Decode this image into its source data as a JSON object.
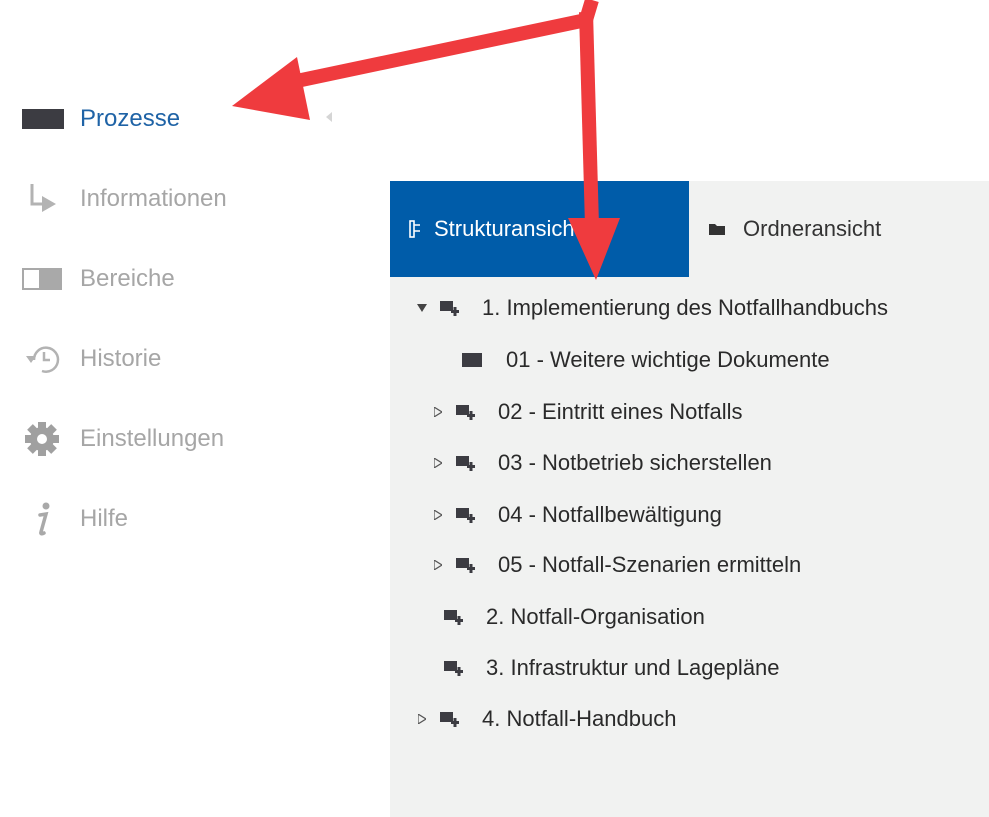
{
  "sidebar": {
    "items": [
      {
        "label": "Prozesse",
        "icon": "process-block-icon",
        "active": true
      },
      {
        "label": "Informationen",
        "icon": "info-arrow-icon",
        "active": false
      },
      {
        "label": "Bereiche",
        "icon": "areas-panel-icon",
        "active": false
      },
      {
        "label": "Historie",
        "icon": "history-clock-icon",
        "active": false
      },
      {
        "label": "Einstellungen",
        "icon": "gear-icon",
        "active": false
      },
      {
        "label": "Hilfe",
        "icon": "info-i-icon",
        "active": false
      }
    ]
  },
  "panel": {
    "tabs": [
      {
        "label": "Strukturansicht",
        "icon": "structure-view-icon",
        "active": true
      },
      {
        "label": "Ordneransicht",
        "icon": "folder-icon",
        "active": false
      }
    ],
    "tree": [
      {
        "label": "1. Implementierung des Notfallhandbuchs",
        "toggle": "expanded",
        "icon": "process-add-icon"
      },
      {
        "label": "01 - Weitere wichtige Dokumente",
        "toggle": "none",
        "icon": "document-block-icon"
      },
      {
        "label": "02 - Eintritt eines Notfalls",
        "toggle": "collapsed",
        "icon": "process-add-icon"
      },
      {
        "label": "03 - Notbetrieb sicherstellen",
        "toggle": "collapsed",
        "icon": "process-add-icon"
      },
      {
        "label": "04 - Notfallbewältigung",
        "toggle": "collapsed",
        "icon": "process-add-icon"
      },
      {
        "label": "05 - Notfall-Szenarien ermitteln",
        "toggle": "collapsed",
        "icon": "process-add-icon"
      },
      {
        "label": "2. Notfall-Organisation",
        "toggle": "none",
        "icon": "process-add-icon"
      },
      {
        "label": "3. Infrastruktur und Lagepläne",
        "toggle": "none",
        "icon": "process-add-icon"
      },
      {
        "label": "4. Notfall-Handbuch",
        "toggle": "collapsed",
        "icon": "process-add-icon"
      }
    ]
  },
  "colors": {
    "accent": "#005ca9",
    "active_text": "#1f63a6",
    "inactive_text": "#a6a6a6",
    "panel_bg": "#f1f2f1",
    "arrow": "#ef3b3e"
  }
}
